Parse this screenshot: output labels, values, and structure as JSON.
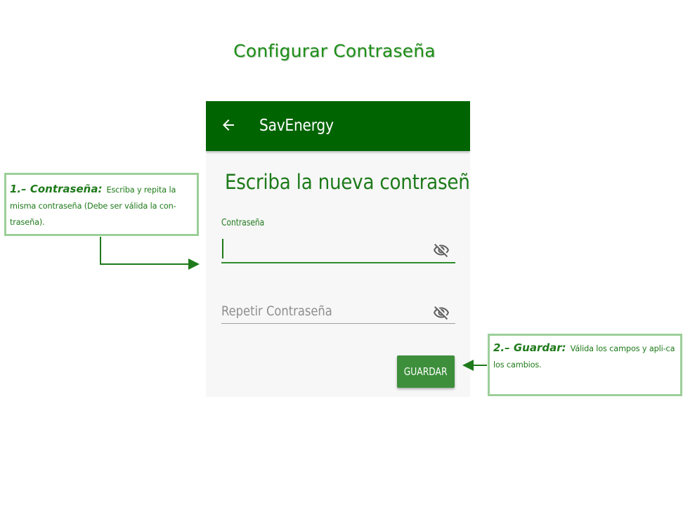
{
  "document": {
    "title": "Configurar Contraseña"
  },
  "app": {
    "appbar": {
      "back_icon": "arrow-back-icon",
      "title": "SavEnergy",
      "color": "#006400"
    },
    "heading": "Escriba la nueva contraseña",
    "password_field": {
      "label": "Contraseña",
      "value": "",
      "icon": "visibility-off-icon"
    },
    "repeat_field": {
      "placeholder": "Repetir Contraseña",
      "value": "",
      "icon": "visibility-off-icon"
    },
    "save_button": {
      "label": "GUARDAR",
      "color": "#3d8f3b"
    },
    "accent_color": "#1e7a1a"
  },
  "callouts": [
    {
      "heading": "1.– Contraseña:",
      "text": "Escriba y repita la misma contraseña (Debe ser válida la con-traseña)."
    },
    {
      "heading": "2.– Guardar:",
      "text": "Válida los campos y apli-ca los cambios."
    }
  ]
}
